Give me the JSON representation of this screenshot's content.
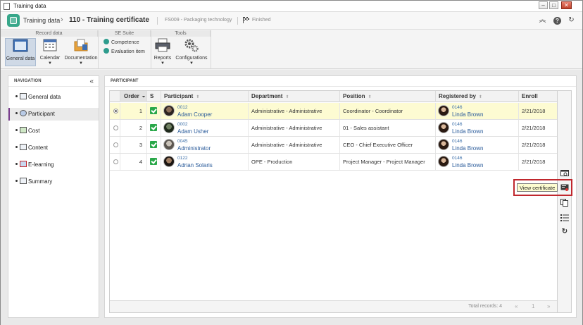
{
  "window": {
    "title": "Training data"
  },
  "header": {
    "crumb1": "Training data",
    "crumb2": "110 - Training certificate",
    "meta1": "FS009 - Packaging technology",
    "status": "Finished"
  },
  "ribbon": {
    "groups": {
      "record_data": "Record data",
      "se_suite": "SE Suite",
      "tools": "Tools"
    },
    "general_data": "General data",
    "calendar": "Calendar",
    "documentation": "Documentation",
    "competence": "Competence",
    "evaluation_item": "Evaluation item",
    "reports": "Reports",
    "configurations": "Configurations"
  },
  "nav": {
    "title": "NAVIGATION",
    "items": [
      {
        "label": "General data"
      },
      {
        "label": "Participant"
      },
      {
        "label": "Cost"
      },
      {
        "label": "Content"
      },
      {
        "label": "E-learning"
      },
      {
        "label": "Summary"
      }
    ]
  },
  "panel": {
    "title": "PARTICIPANT"
  },
  "grid": {
    "columns": [
      "Order",
      "S",
      "Participant",
      "Department",
      "Position",
      "Registered by",
      "Enroll date"
    ],
    "rows": [
      {
        "order": "1",
        "code": "0012",
        "name": "Adam Cooper",
        "department": "Administrative - Administrative",
        "position": "Coordinator - Coordinator",
        "reg_code": "0146",
        "reg_name": "Linda Brown",
        "date": "2/21/2018"
      },
      {
        "order": "2",
        "code": "0002",
        "name": "Adam Usher",
        "department": "Administrative - Administrative",
        "position": "01 - Sales assistant",
        "reg_code": "0146",
        "reg_name": "Linda Brown",
        "date": "2/21/2018"
      },
      {
        "order": "3",
        "code": "0045",
        "name": "Administrator",
        "department": "Administrative - Administrative",
        "position": "CEO - Chief Executive Officer",
        "reg_code": "0146",
        "reg_name": "Linda Brown",
        "date": "2/21/2018"
      },
      {
        "order": "4",
        "code": "0122",
        "name": "Adrian Solaris",
        "department": "OPE - Production",
        "position": "Project Manager - Project Manager",
        "reg_code": "0146",
        "reg_name": "Linda Brown",
        "date": "2/21/2018"
      }
    ],
    "total": "Total records: 4",
    "page": "1"
  },
  "tooltip": {
    "view_certificate": "View certificate"
  },
  "colors": {
    "accent": "#37a78a",
    "selected_row": "#fdfbd2",
    "highlight": "#c0272d",
    "nav_active": "#7b3f8f"
  }
}
